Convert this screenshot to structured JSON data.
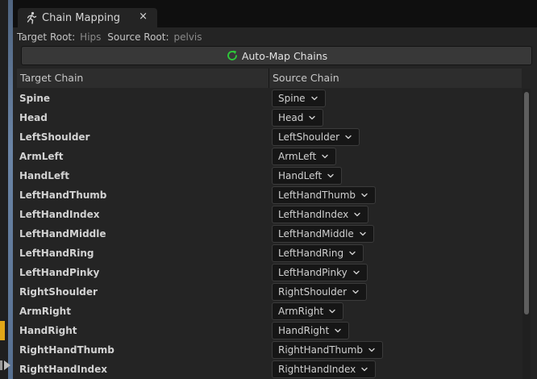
{
  "tab": {
    "title": "Chain Mapping",
    "close": "×"
  },
  "roots": {
    "target_label": "Target Root:",
    "target_value": "Hips",
    "source_label": "Source Root:",
    "source_value": "pelvis"
  },
  "automap": {
    "label": "Auto-Map Chains"
  },
  "columns": {
    "target": "Target Chain",
    "source": "Source Chain"
  },
  "rows": [
    {
      "target": "Spine",
      "source": "Spine"
    },
    {
      "target": "Head",
      "source": "Head"
    },
    {
      "target": "LeftShoulder",
      "source": "LeftShoulder"
    },
    {
      "target": "ArmLeft",
      "source": "ArmLeft"
    },
    {
      "target": "HandLeft",
      "source": "HandLeft"
    },
    {
      "target": "LeftHandThumb",
      "source": "LeftHandThumb"
    },
    {
      "target": "LeftHandIndex",
      "source": "LeftHandIndex"
    },
    {
      "target": "LeftHandMiddle",
      "source": "LeftHandMiddle"
    },
    {
      "target": "LeftHandRing",
      "source": "LeftHandRing"
    },
    {
      "target": "LeftHandPinky",
      "source": "LeftHandPinky"
    },
    {
      "target": "RightShoulder",
      "source": "RightShoulder"
    },
    {
      "target": "ArmRight",
      "source": "ArmRight"
    },
    {
      "target": "HandRight",
      "source": "HandRight"
    },
    {
      "target": "RightHandThumb",
      "source": "RightHandThumb"
    },
    {
      "target": "RightHandIndex",
      "source": "RightHandIndex"
    }
  ],
  "colors": {
    "panel_bg": "#242424",
    "accent_refresh": "#2ecb3a",
    "left_accent": "#6b85a6",
    "left_highlight": "#e1a717"
  },
  "icons": {
    "tab": "running-figure-icon",
    "automap": "refresh-icon",
    "dropdown": "chevron-down-icon",
    "close": "close-icon"
  }
}
